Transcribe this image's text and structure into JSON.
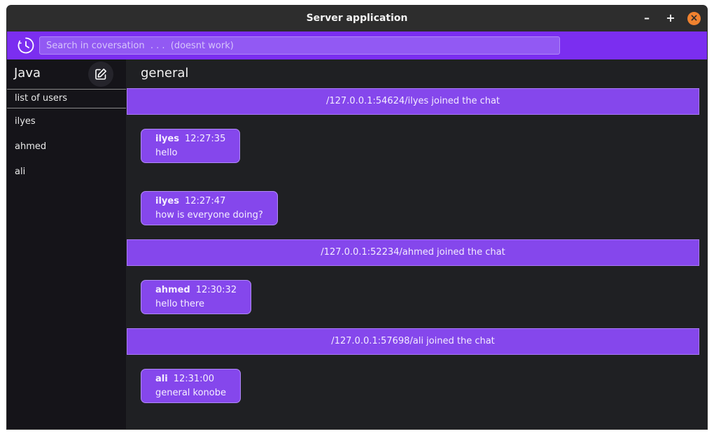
{
  "window": {
    "title": "Server application",
    "controls": {
      "minimize": "–",
      "maximize": "+",
      "close": "×"
    }
  },
  "toolbar": {
    "history_icon": "clock-history-icon",
    "search_placeholder": "Search in coversation  . . .  (doesnt work)"
  },
  "sidebar": {
    "app_name": "Java",
    "compose_icon": "edit-square-icon",
    "users_header": "list of users",
    "users": [
      "ilyes",
      "ahmed",
      "ali"
    ]
  },
  "main": {
    "channel": "general",
    "events": [
      {
        "type": "join",
        "text": "/127.0.0.1:54624/ilyes joined the chat"
      },
      {
        "type": "message",
        "author": "ilyes",
        "time": "12:27:35",
        "text": "hello"
      },
      {
        "type": "message",
        "author": "ilyes",
        "time": "12:27:47",
        "text": "how is everyone doing?"
      },
      {
        "type": "join",
        "text": "/127.0.0.1:52234/ahmed joined the chat"
      },
      {
        "type": "message",
        "author": "ahmed",
        "time": "12:30:32",
        "text": "hello there"
      },
      {
        "type": "join",
        "text": "/127.0.0.1:57698/ali joined the chat"
      },
      {
        "type": "message",
        "author": "ali",
        "time": "12:31:00",
        "text": "general konobe"
      }
    ]
  },
  "colors": {
    "accent": "#7b2ef0",
    "bubble": "#8547ec",
    "sidebar_bg": "#151419",
    "main_bg": "#1f2023",
    "titlebar_bg": "#2d2d2d",
    "close_button": "#f0822f"
  }
}
